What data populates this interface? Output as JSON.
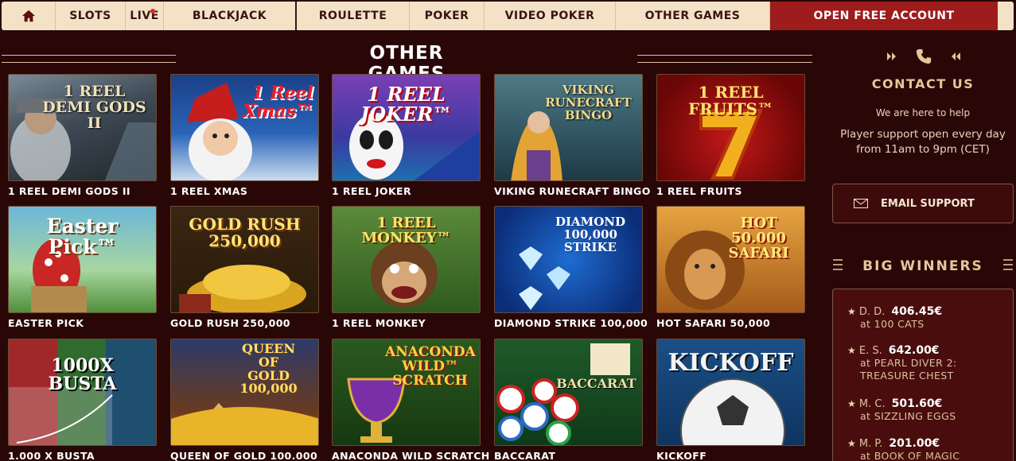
{
  "nav": {
    "items": [
      "SLOTS",
      "LIVE",
      "BLACKJACK",
      "ROULETTE",
      "POKER",
      "VIDEO POKER",
      "OTHER GAMES"
    ],
    "cta": "OPEN FREE ACCOUNT"
  },
  "section": {
    "title": "OTHER GAMES"
  },
  "games": [
    {
      "caption": "1 REEL DEMI GODS II",
      "art": "1 REEL\nDEMI GODS II"
    },
    {
      "caption": "1 REEL XMAS",
      "art": "1 Reel Xmas™"
    },
    {
      "caption": "1 REEL JOKER",
      "art": "1 REEL JOKER™"
    },
    {
      "caption": "VIKING RUNECRAFT BINGO",
      "art": "VIKING\nRUNECRAFT\nBINGO"
    },
    {
      "caption": "1 REEL FRUITS",
      "art": "1 REEL FRUITS™"
    },
    {
      "caption": "EASTER PICK",
      "art": "Easter Pick™"
    },
    {
      "caption": "GOLD RUSH 250,000",
      "art": "GOLD RUSH\n250,000"
    },
    {
      "caption": "1 REEL MONKEY",
      "art": "1 REEL MONKEY™"
    },
    {
      "caption": "DIAMOND STRIKE 100,000",
      "art": "DIAMOND\n100,000\nSTRIKE"
    },
    {
      "caption": "HOT SAFARI 50,000",
      "art": "HOT\n50.000\nSAFARI"
    },
    {
      "caption": "1.000 X BUSTA",
      "art": "1000X\nBUSTA"
    },
    {
      "caption": "QUEEN OF GOLD 100.000",
      "art": "QUEEN\nOF\nGOLD\n100,000"
    },
    {
      "caption": "ANACONDA WILD SCRATCH",
      "art": "ANACONDA\nWILD™\nSCRATCH"
    },
    {
      "caption": "BACCARAT",
      "art": "BACCARAT"
    },
    {
      "caption": "KICKOFF",
      "art": "KICKOFF"
    }
  ],
  "contact": {
    "title": "CONTACT US",
    "help": "We are here to help",
    "hours": "Player support open every day from 11am to 9pm (CET)",
    "email_button": "EMAIL SUPPORT"
  },
  "winners": {
    "title": "BIG WINNERS",
    "items": [
      {
        "who": "D. D.",
        "amount": "406.45€",
        "game": "at 100 CATS"
      },
      {
        "who": "E. S.",
        "amount": "642.00€",
        "game": "at PEARL DIVER 2: TREASURE CHEST"
      },
      {
        "who": "M. C.",
        "amount": "501.60€",
        "game": "at SIZZLING EGGS"
      },
      {
        "who": "M. P.",
        "amount": "201.00€",
        "game": "at BOOK OF MAGIC"
      }
    ]
  },
  "colors": {
    "background": "#2a0707",
    "nav_bg": "#f4e2c7",
    "cta_bg": "#9e1c1c",
    "accent_gold": "#e3c79a"
  }
}
